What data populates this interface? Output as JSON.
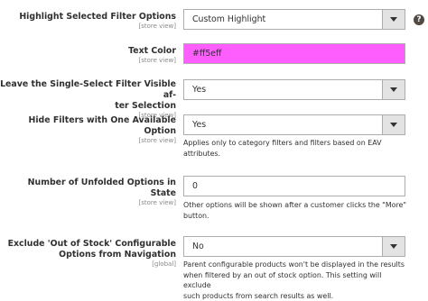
{
  "fields": {
    "highlight": {
      "label": "Highlight Selected Filter Options",
      "scope": "[store view]",
      "value": "Custom Highlight"
    },
    "text_color": {
      "label": "Text Color",
      "scope": "[store view]",
      "value": "#ff5eff",
      "swatch": "#ff5eff"
    },
    "leave_visible": {
      "label_line1": "Leave the Single-Select Filter Visible af-",
      "label_line2": "ter Selection",
      "scope": "[store view]",
      "value": "Yes"
    },
    "hide_filters": {
      "label": "Hide Filters with One Available Option",
      "scope": "[store view]",
      "value": "Yes",
      "note_line1": "Applies only to category filters and filters based on EAV",
      "note_line2": "attributes."
    },
    "unfolded": {
      "label": "Number of Unfolded Options in State",
      "scope": "[store view]",
      "value": "0",
      "note_line1": "Other options will be shown after a customer clicks the \"More\"",
      "note_line2": "button."
    },
    "exclude_oos": {
      "label_line1": "Exclude 'Out of Stock' Configurable",
      "label_line2": "Options from Navigation",
      "scope": "[global]",
      "value": "No",
      "note_line1": "Parent configurable products won't be displayed in the results",
      "note_line2": "when filtered by an out of stock option. This setting will exclude",
      "note_line3": "such products from search results as well."
    }
  },
  "help": {
    "glyph": "?"
  },
  "icons": {
    "dropdown": "chevron-down-icon",
    "help": "help-icon"
  }
}
